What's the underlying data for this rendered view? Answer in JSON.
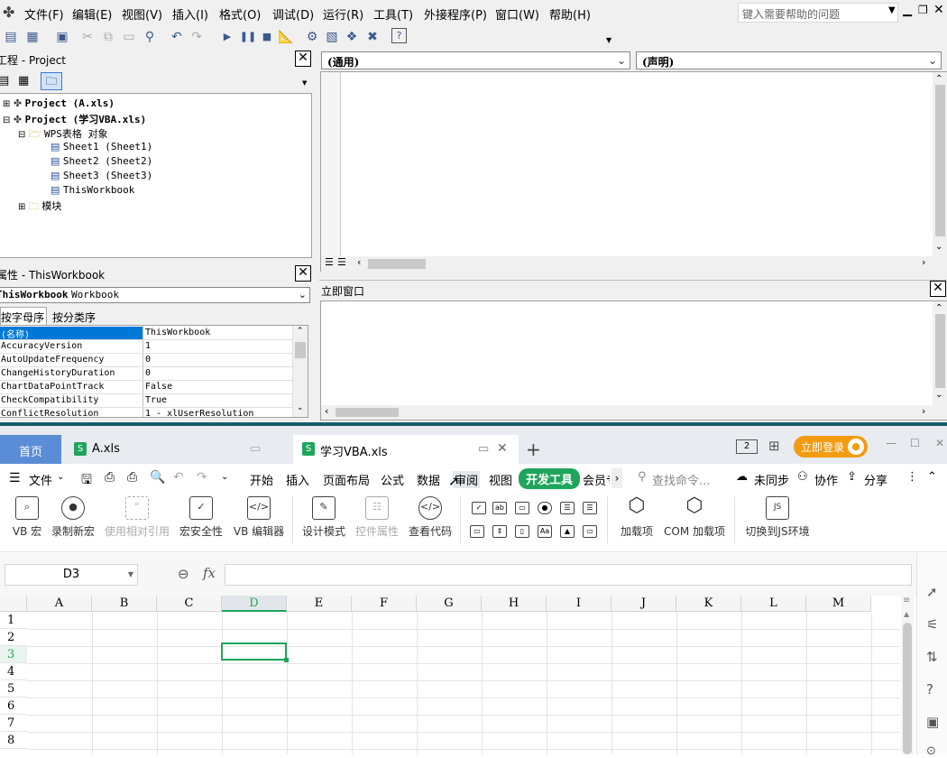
{
  "vbe": {
    "menu": [
      "文件(F)",
      "编辑(E)",
      "视图(V)",
      "插入(I)",
      "格式(O)",
      "调试(D)",
      "运行(R)",
      "工具(T)",
      "外接程序(P)",
      "窗口(W)",
      "帮助(H)"
    ],
    "help_placeholder": "键入需要帮助的问题",
    "project_pane": {
      "title": "工程 - Project",
      "tree": [
        {
          "text": "Project (A.xls)",
          "level": 0,
          "bold": true
        },
        {
          "text": "Project (学习VBA.xls)",
          "level": 0,
          "bold": true
        },
        {
          "text": "WPS表格 对象",
          "level": 1
        },
        {
          "text": "Sheet1 (Sheet1)",
          "level": 2
        },
        {
          "text": "Sheet2 (Sheet2)",
          "level": 2
        },
        {
          "text": "Sheet3 (Sheet3)",
          "level": 2
        },
        {
          "text": "ThisWorkbook",
          "level": 2
        },
        {
          "text": "模块",
          "level": 1
        }
      ]
    },
    "props_pane": {
      "title": "属性 - ThisWorkbook",
      "object_combo": "ThisWorkbook",
      "object_type": "Workbook",
      "tabs": [
        "按字母序",
        "按分类序"
      ],
      "rows": [
        {
          "name": "(名称)",
          "value": "ThisWorkbook"
        },
        {
          "name": "AccuracyVersion",
          "value": "1"
        },
        {
          "name": "AutoUpdateFrequency",
          "value": "0"
        },
        {
          "name": "ChangeHistoryDuration",
          "value": "0"
        },
        {
          "name": "ChartDataPointTrack",
          "value": "False"
        },
        {
          "name": "CheckCompatibility",
          "value": "True"
        },
        {
          "name": "ConflictResolution",
          "value": "1 - xlUserResolution"
        }
      ]
    },
    "code": {
      "general_combo": "(通用)",
      "decl_combo": "(声明)"
    },
    "immediate_title": "立即窗口"
  },
  "wps": {
    "tabs": {
      "home": "首页",
      "file1": "A.xls",
      "file2": "学习VBA.xls"
    },
    "login": "立即登录",
    "file_menu": "文件",
    "ribbon_tabs": [
      "开始",
      "插入",
      "页面布局",
      "公式",
      "数据",
      "审阅",
      "视图",
      "开发工具",
      "会员专"
    ],
    "search_cmd": "查找命令...",
    "sync": "未同步",
    "collab": "协作",
    "share": "分享",
    "buttons": [
      "VB 宏",
      "录制新宏",
      "使用相对引用",
      "宏安全性",
      "VB 编辑器",
      "设计模式",
      "控件属性",
      "查看代码",
      "加载项",
      "COM 加载项",
      "切换到JS环境"
    ],
    "name_box": "D3",
    "fx": "fx",
    "columns": [
      "A",
      "B",
      "C",
      "D",
      "E",
      "F",
      "G",
      "H",
      "I",
      "J",
      "K",
      "L",
      "M"
    ],
    "rows": [
      "1",
      "2",
      "3",
      "4",
      "5",
      "6",
      "7",
      "8"
    ],
    "selected_cell": "D3"
  },
  "colors": {
    "accent": "#1fa55b",
    "tabbar": "#135e6c",
    "selection": "#0078d7"
  }
}
